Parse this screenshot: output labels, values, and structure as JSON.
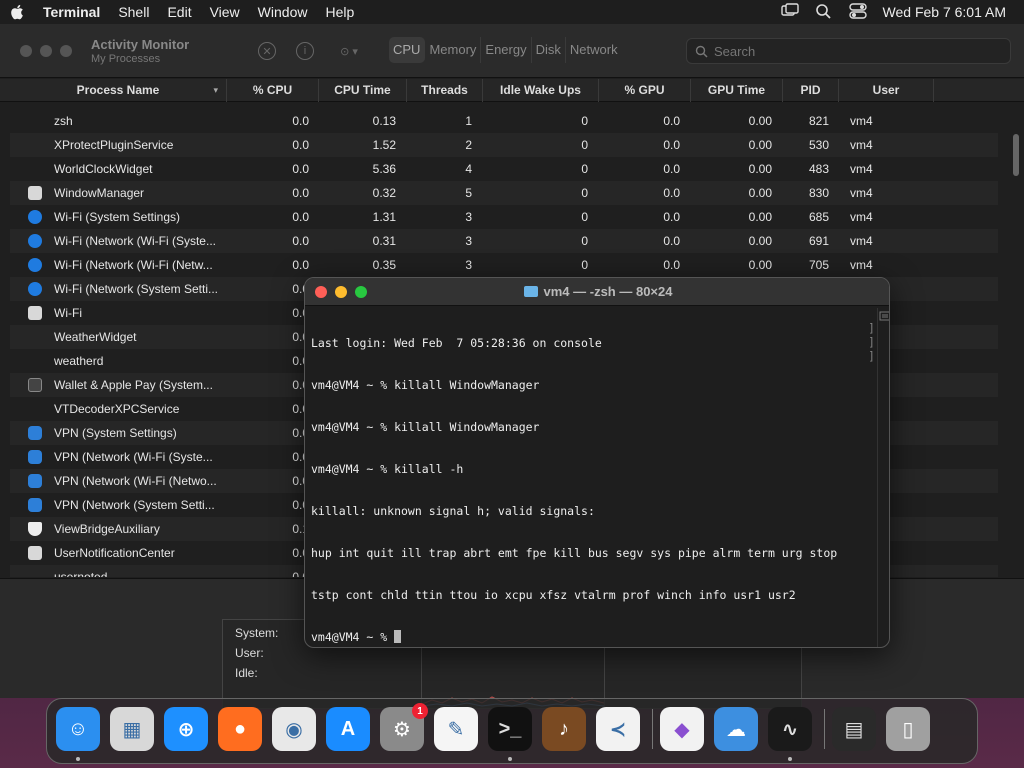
{
  "menubar": {
    "app": "Terminal",
    "items": [
      "Shell",
      "Edit",
      "View",
      "Window",
      "Help"
    ],
    "clock": "Wed Feb 7  6:01 AM"
  },
  "activity_monitor": {
    "title": "Activity Monitor",
    "subtitle": "My Processes",
    "tabs": [
      "CPU",
      "Memory",
      "Energy",
      "Disk",
      "Network"
    ],
    "active_tab": "CPU",
    "search_placeholder": "Search",
    "columns": [
      "Process Name",
      "% CPU",
      "CPU Time",
      "Threads",
      "Idle Wake Ups",
      "% GPU",
      "GPU Time",
      "PID",
      "User"
    ],
    "rows": [
      {
        "icon": "none",
        "name": "zsh",
        "cpu": "0.0",
        "cpu_time": "0.13",
        "threads": "1",
        "wakeups": "0",
        "gpu": "0.0",
        "gpu_time": "0.00",
        "pid": "821",
        "user": "vm4"
      },
      {
        "icon": "none",
        "name": "XProtectPluginService",
        "cpu": "0.0",
        "cpu_time": "1.52",
        "threads": "2",
        "wakeups": "0",
        "gpu": "0.0",
        "gpu_time": "0.00",
        "pid": "530",
        "user": "vm4"
      },
      {
        "icon": "none",
        "name": "WorldClockWidget",
        "cpu": "0.0",
        "cpu_time": "5.36",
        "threads": "4",
        "wakeups": "0",
        "gpu": "0.0",
        "gpu_time": "0.00",
        "pid": "483",
        "user": "vm4"
      },
      {
        "icon": "blank",
        "name": "WindowManager",
        "cpu": "0.0",
        "cpu_time": "0.32",
        "threads": "5",
        "wakeups": "0",
        "gpu": "0.0",
        "gpu_time": "0.00",
        "pid": "830",
        "user": "vm4"
      },
      {
        "icon": "wifi",
        "name": "Wi-Fi (System Settings)",
        "cpu": "0.0",
        "cpu_time": "1.31",
        "threads": "3",
        "wakeups": "0",
        "gpu": "0.0",
        "gpu_time": "0.00",
        "pid": "685",
        "user": "vm4"
      },
      {
        "icon": "wifi",
        "name": "Wi-Fi (Network (Wi-Fi (Syste...",
        "cpu": "0.0",
        "cpu_time": "0.31",
        "threads": "3",
        "wakeups": "0",
        "gpu": "0.0",
        "gpu_time": "0.00",
        "pid": "691",
        "user": "vm4"
      },
      {
        "icon": "wifi",
        "name": "Wi-Fi (Network (Wi-Fi (Netw...",
        "cpu": "0.0",
        "cpu_time": "0.35",
        "threads": "3",
        "wakeups": "0",
        "gpu": "0.0",
        "gpu_time": "0.00",
        "pid": "705",
        "user": "vm4"
      },
      {
        "icon": "wifi",
        "name": "Wi-Fi (Network (System Setti...",
        "cpu": "0.0",
        "cpu_time": "",
        "threads": "",
        "wakeups": "",
        "gpu": "",
        "gpu_time": "",
        "pid": "",
        "user": ""
      },
      {
        "icon": "blank",
        "name": "Wi-Fi",
        "cpu": "0.0",
        "cpu_time": "",
        "threads": "",
        "wakeups": "",
        "gpu": "",
        "gpu_time": "",
        "pid": "",
        "user": ""
      },
      {
        "icon": "none",
        "name": "WeatherWidget",
        "cpu": "0.0",
        "cpu_time": "",
        "threads": "",
        "wakeups": "",
        "gpu": "",
        "gpu_time": "",
        "pid": "",
        "user": ""
      },
      {
        "icon": "none",
        "name": "weatherd",
        "cpu": "0.0",
        "cpu_time": "",
        "threads": "",
        "wakeups": "",
        "gpu": "",
        "gpu_time": "",
        "pid": "",
        "user": ""
      },
      {
        "icon": "wallet",
        "name": "Wallet & Apple Pay (System...",
        "cpu": "0.0",
        "cpu_time": "",
        "threads": "",
        "wakeups": "",
        "gpu": "",
        "gpu_time": "",
        "pid": "",
        "user": ""
      },
      {
        "icon": "none",
        "name": "VTDecoderXPCService",
        "cpu": "0.0",
        "cpu_time": "",
        "threads": "",
        "wakeups": "",
        "gpu": "",
        "gpu_time": "",
        "pid": "",
        "user": ""
      },
      {
        "icon": "vpn",
        "name": "VPN (System Settings)",
        "cpu": "0.0",
        "cpu_time": "",
        "threads": "",
        "wakeups": "",
        "gpu": "",
        "gpu_time": "",
        "pid": "",
        "user": ""
      },
      {
        "icon": "vpn",
        "name": "VPN (Network (Wi-Fi (Syste...",
        "cpu": "0.0",
        "cpu_time": "",
        "threads": "",
        "wakeups": "",
        "gpu": "",
        "gpu_time": "",
        "pid": "",
        "user": ""
      },
      {
        "icon": "vpn",
        "name": "VPN (Network (Wi-Fi (Netwo...",
        "cpu": "0.0",
        "cpu_time": "",
        "threads": "",
        "wakeups": "",
        "gpu": "",
        "gpu_time": "",
        "pid": "",
        "user": ""
      },
      {
        "icon": "vpn",
        "name": "VPN (Network (System Setti...",
        "cpu": "0.0",
        "cpu_time": "",
        "threads": "",
        "wakeups": "",
        "gpu": "",
        "gpu_time": "",
        "pid": "",
        "user": ""
      },
      {
        "icon": "shield",
        "name": "ViewBridgeAuxiliary",
        "cpu": "0.1",
        "cpu_time": "",
        "threads": "",
        "wakeups": "",
        "gpu": "",
        "gpu_time": "",
        "pid": "",
        "user": ""
      },
      {
        "icon": "blank",
        "name": "UserNotificationCenter",
        "cpu": "0.0",
        "cpu_time": "",
        "threads": "",
        "wakeups": "",
        "gpu": "",
        "gpu_time": "",
        "pid": "",
        "user": ""
      },
      {
        "icon": "none",
        "name": "usernoted",
        "cpu": "0.0",
        "cpu_time": "",
        "threads": "",
        "wakeups": "",
        "gpu": "",
        "gpu_time": "",
        "pid": "",
        "user": ""
      }
    ],
    "stats": {
      "system_label": "System:",
      "user_label": "User:",
      "idle_label": "Idle:"
    }
  },
  "terminal": {
    "title": "vm4 — -zsh — 80×24",
    "lines": [
      "Last login: Wed Feb  7 05:28:36 on console",
      "vm4@VM4 ~ % killall WindowManager",
      "vm4@VM4 ~ % killall WindowManager",
      "vm4@VM4 ~ % killall -h",
      "killall: unknown signal h; valid signals:",
      "hup int quit ill trap abrt emt fpe kill bus segv sys pipe alrm term urg stop",
      "tstp cont chld ttin ttou io xcpu xfsz vtalrm prof winch info usr1 usr2"
    ],
    "prompt": "vm4@VM4 ~ % "
  },
  "dock": {
    "items": [
      {
        "name": "finder",
        "color": "#2b8ff0",
        "running": true
      },
      {
        "name": "launchpad",
        "color": "#d8d8d8",
        "running": false
      },
      {
        "name": "safari",
        "color": "#1e90ff",
        "running": false
      },
      {
        "name": "firefox",
        "color": "#ff6d1f",
        "running": false
      },
      {
        "name": "chrome",
        "color": "#e8e8e8",
        "running": false
      },
      {
        "name": "app-store",
        "color": "#1a8cff",
        "running": false
      },
      {
        "name": "system-settings",
        "color": "#8a8a8a",
        "running": false,
        "badge": "1"
      },
      {
        "name": "textedit",
        "color": "#f5f5f5",
        "running": false
      },
      {
        "name": "terminal",
        "color": "#111111",
        "running": true
      },
      {
        "name": "instruments",
        "color": "#7a4a22",
        "running": false
      },
      {
        "name": "vscode",
        "color": "#f2f2f2",
        "running": false
      },
      {
        "name": "visual-studio",
        "color": "#f2f2f2",
        "running": false
      },
      {
        "name": "weather",
        "color": "#3d8fe0",
        "running": false
      },
      {
        "name": "activity-monitor",
        "color": "#1a1a1a",
        "running": true
      },
      {
        "name": "recent-window",
        "color": "#2a2a2a",
        "running": false
      },
      {
        "name": "trash",
        "color": "#a0a0a0",
        "running": false
      }
    ]
  },
  "colors": {
    "accent": "#1f7be0",
    "close": "#ff5f57",
    "minimize": "#febc2e",
    "zoom": "#28c840"
  }
}
